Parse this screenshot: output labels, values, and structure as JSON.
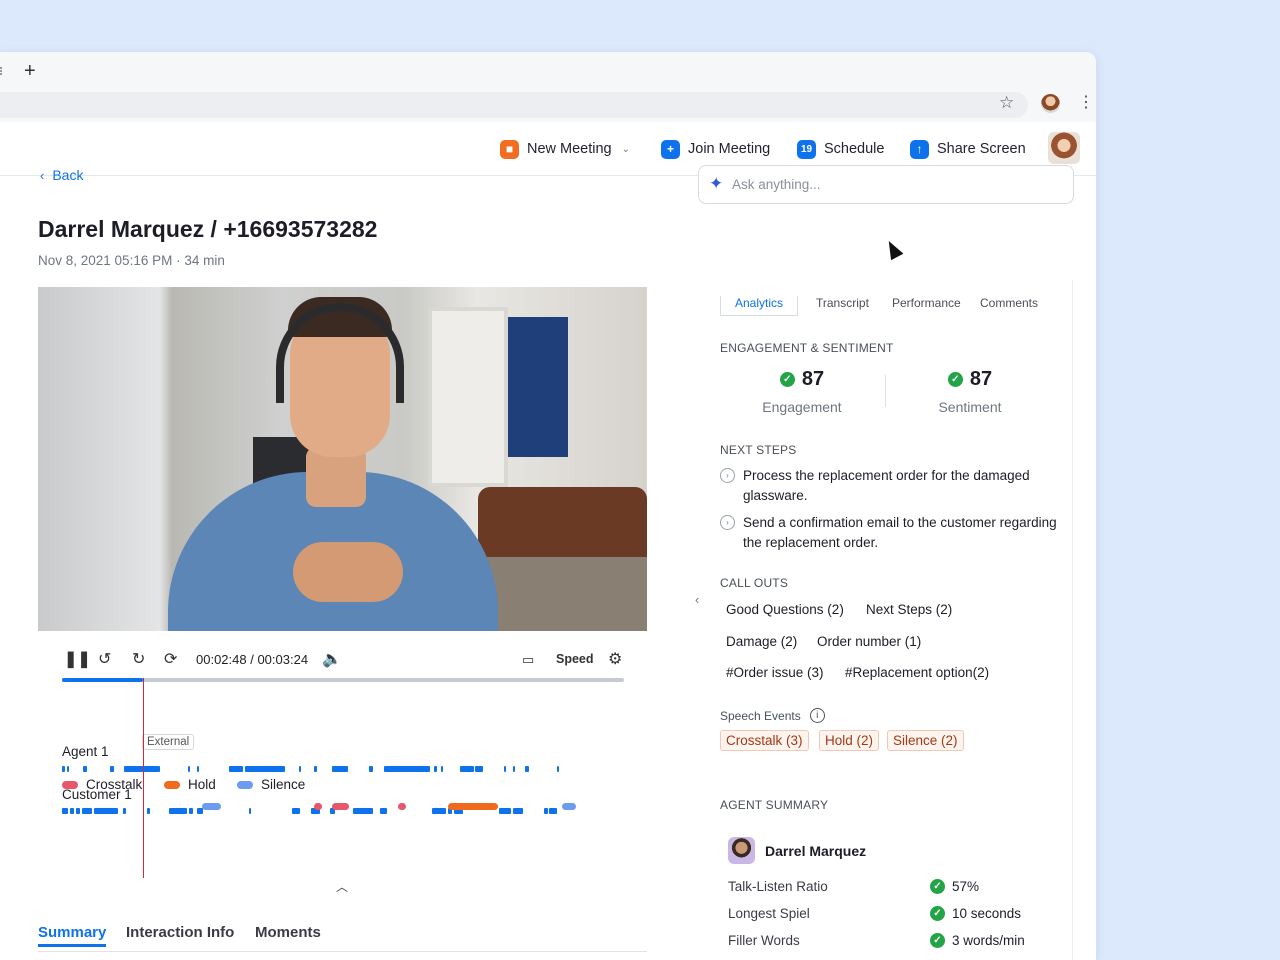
{
  "browser": {
    "new_tab_icon": "plus-icon",
    "bookmark_icon": "star-icon",
    "menu_icon": "kebab-icon"
  },
  "header": {
    "new_meeting": "New Meeting",
    "join_meeting": "Join Meeting",
    "schedule": "Schedule",
    "schedule_date": "19",
    "share_screen": "Share Screen",
    "accent_orange": "#f26d21",
    "accent_blue": "#0e72ed"
  },
  "call": {
    "back": "Back",
    "title": "Darrel Marquez / +16693573282",
    "meta": "Nov 8, 2021 05:16 PM · 34 min"
  },
  "player": {
    "timecode": "00:02:48 / 00:03:24",
    "speed": "Speed",
    "progress": 0.145
  },
  "timeline": {
    "agent_label": "Agent 1",
    "customer_label": "Customer 1",
    "external_tag": "External",
    "agent_segments": [
      [
        0,
        3
      ],
      [
        5,
        2
      ],
      [
        21,
        4
      ],
      [
        48,
        4
      ],
      [
        62,
        36
      ],
      [
        126,
        2
      ],
      [
        135,
        2
      ],
      [
        167,
        14
      ],
      [
        183,
        40
      ],
      [
        237,
        2
      ],
      [
        252,
        3
      ],
      [
        270,
        16
      ],
      [
        307,
        4
      ],
      [
        322,
        46
      ],
      [
        372,
        3
      ],
      [
        379,
        2
      ],
      [
        398,
        14
      ],
      [
        413,
        8
      ],
      [
        442,
        2
      ],
      [
        451,
        2
      ],
      [
        463,
        4
      ],
      [
        495,
        2
      ]
    ],
    "customer_segments": [
      [
        0,
        6
      ],
      [
        8,
        4
      ],
      [
        14,
        4
      ],
      [
        20,
        10
      ],
      [
        32,
        24
      ],
      [
        61,
        3
      ],
      [
        85,
        3
      ],
      [
        107,
        18
      ],
      [
        127,
        4
      ],
      [
        135,
        6
      ],
      [
        187,
        2
      ],
      [
        230,
        8
      ],
      [
        249,
        9
      ],
      [
        268,
        5
      ],
      [
        291,
        20
      ],
      [
        318,
        7
      ],
      [
        370,
        14
      ],
      [
        386,
        4
      ],
      [
        392,
        9
      ],
      [
        437,
        2
      ],
      [
        438,
        11
      ],
      [
        451,
        10
      ],
      [
        482,
        4
      ],
      [
        487,
        8
      ]
    ],
    "legend": [
      "Crosstalk",
      "Hold",
      "Silence"
    ],
    "colors": {
      "crosstalk": "#e8566a",
      "hold": "#ef6a1d",
      "silence": "#6c9cf0"
    },
    "events": [
      {
        "type": "silence",
        "start": 140,
        "width": 19
      },
      {
        "type": "crosstalk",
        "start": 252,
        "width": 8
      },
      {
        "type": "crosstalk",
        "start": 270,
        "width": 17
      },
      {
        "type": "crosstalk",
        "start": 336,
        "width": 8
      },
      {
        "type": "hold",
        "start": 386,
        "width": 50
      },
      {
        "type": "silence",
        "start": 500,
        "width": 14
      }
    ]
  },
  "bottom_tabs": [
    "Summary",
    "Interaction Info",
    "Moments"
  ],
  "ask": {
    "placeholder": "Ask anything..."
  },
  "right_tabs": [
    "Analytics",
    "Transcript",
    "Performance",
    "Comments"
  ],
  "engagement": {
    "heading": "ENGAGEMENT & SENTIMENT",
    "engagement_value": "87",
    "engagement_label": "Engagement",
    "sentiment_value": "87",
    "sentiment_label": "Sentiment"
  },
  "next_steps": {
    "heading": "NEXT STEPS",
    "items": [
      "Process the replacement order for the damaged glassware.",
      "Send a confirmation email to the customer regarding the replacement order."
    ]
  },
  "call_outs": {
    "heading": "CALL OUTS",
    "tags": [
      "Good Questions (2)",
      "Next Steps (2)",
      "Damage (2)",
      "Order number (1)",
      "#Order issue (3)",
      "#Replacement option(2)"
    ]
  },
  "speech_events": {
    "heading": "Speech Events",
    "tags": [
      "Crosstalk (3)",
      "Hold (2)",
      "Silence (2)"
    ]
  },
  "agent_summary": {
    "heading": "AGENT SUMMARY",
    "name": "Darrel Marquez",
    "stats": [
      {
        "label": "Talk-Listen Ratio",
        "value": "57%"
      },
      {
        "label": "Longest Spiel",
        "value": "10 seconds"
      },
      {
        "label": "Filler Words",
        "value": "3 words/min"
      }
    ]
  }
}
